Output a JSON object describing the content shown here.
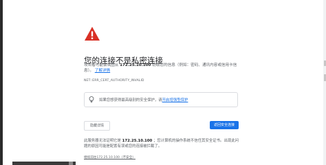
{
  "page": {
    "title": "您的连接不是私密连接",
    "description_prefix": "攻击者可能会试图从",
    "host": "172.25.10.100",
    "description_suffix": "窃取您的信息（例如：密码、通讯内容或信用卡信息）。",
    "learn_more": "了解详情",
    "error_code": "NET::ERR_CERT_AUTHORITY_INVALID"
  },
  "safe_browsing": {
    "text_prefix": "如果您想获得最高级别的安全保护，请",
    "link": "开启增强型保护"
  },
  "buttons": {
    "details": "隐藏详情",
    "back_to_safety": "返回安全连接"
  },
  "details": {
    "text_prefix": "此服务器无法证明它是",
    "host": "172.25.10.100",
    "text_suffix": "；您计算机的操作系统不信任其安全证书。出现此问题的原因可能是配置有误或您的连接被拦截了。",
    "proceed_link": "继续前往172.25.10.100（不安全）"
  },
  "icons": {
    "warning": "warning-icon",
    "lightbulb": "lightbulb-icon"
  },
  "colors": {
    "warning_red": "#d93025",
    "primary_blue": "#1a73e8",
    "text_gray": "#5f6368"
  }
}
